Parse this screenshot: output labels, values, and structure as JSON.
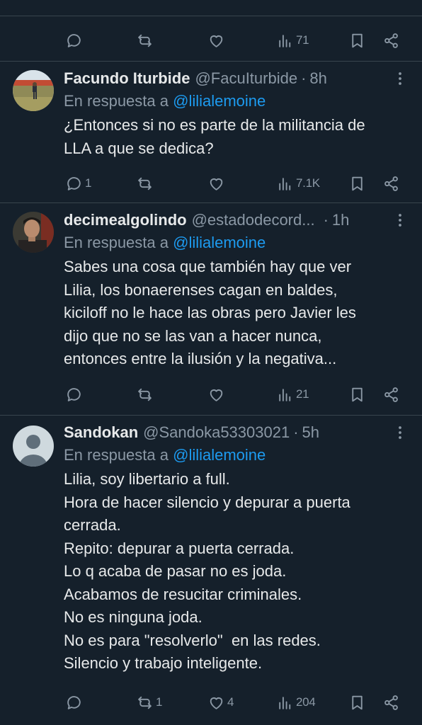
{
  "top_actions": {
    "views": "71"
  },
  "tweets": [
    {
      "name": "Facundo Iturbide",
      "handle": "@FacuIturbide",
      "sep": "·",
      "time": "8h",
      "reply_prefix": "En respuesta a",
      "reply_handle": "@lilialemoine",
      "text": "¿Entonces si no es parte de la militancia de\nLLA a que se dedica?",
      "replies": "1",
      "retweets": "",
      "likes": "",
      "views": "7.1K"
    },
    {
      "name": "decimealgolindo",
      "handle": "@estadodecord...",
      "sep": "·",
      "time": "1h",
      "reply_prefix": "En respuesta a",
      "reply_handle": "@lilialemoine",
      "text": "Sabes una cosa que también hay que ver\nLilia, los bonaerenses cagan en baldes,\nkiciloff no le hace las obras pero Javier les\ndijo que no se las van a hacer nunca,\nentonces entre la ilusión y la negativa...",
      "replies": "",
      "retweets": "",
      "likes": "",
      "views": "21"
    },
    {
      "name": "Sandokan",
      "handle": "@Sandoka53303021",
      "sep": "·",
      "time": "5h",
      "reply_prefix": "En respuesta a",
      "reply_handle": "@lilialemoine",
      "text": "Lilia, soy libertario a full.\nHora de hacer silencio y depurar a puerta\ncerrada.\nRepito: depurar a puerta cerrada.\nLo q acaba de pasar no es joda.\nAcabamos de resucitar criminales.\nNo es ninguna joda.\nNo es para \"resolverlo\"  en las redes.\nSilencio y trabajo inteligente.",
      "replies": "",
      "retweets": "1",
      "likes": "4",
      "views": "204"
    }
  ],
  "icons": {
    "reply": "reply-icon",
    "retweet": "retweet-icon",
    "like": "heart-icon",
    "views": "views-chart-icon",
    "bookmark": "bookmark-icon",
    "share": "share-icon",
    "more": "more-dots-icon"
  },
  "colors": {
    "background": "#15202b",
    "text": "#e7e9ea",
    "secondary": "#8b98a5",
    "link": "#1d9bf0",
    "divider": "#38444d"
  }
}
